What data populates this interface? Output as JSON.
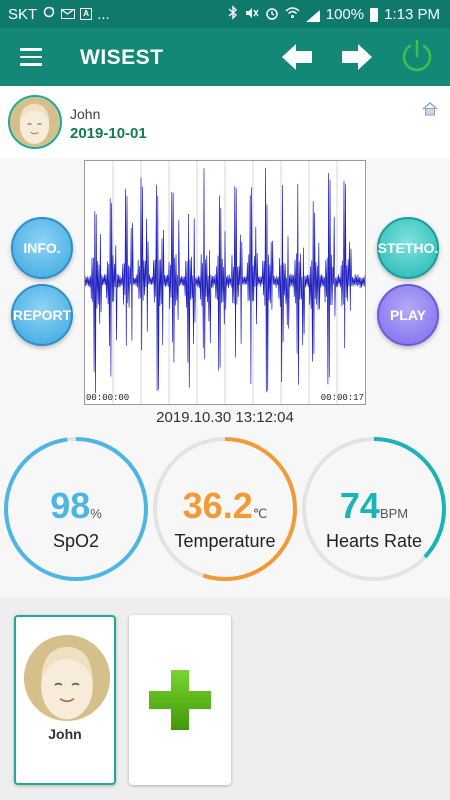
{
  "status_bar": {
    "carrier": "SKT",
    "battery": "100%",
    "time": "1:13 PM",
    "overflow": "..."
  },
  "app_bar": {
    "title": "WISEST",
    "icons": [
      "menu-icon",
      "arrow-left-icon",
      "arrow-right-icon",
      "power-icon"
    ],
    "power_color": "#39c44a"
  },
  "profile": {
    "name": "John",
    "date": "2019-10-01"
  },
  "buttons": {
    "info": "INFO.",
    "report": "REPORT",
    "stetho": "STETHO.",
    "play": "PLAY"
  },
  "waveform": {
    "start_time": "00:00:00",
    "end_time": "00:00:17",
    "color": "#1f1fbf"
  },
  "recording_timestamp": "2019.10.30 13:12:04",
  "vitals": [
    {
      "value": "98",
      "unit": "%",
      "label": "SpO2",
      "color": "#4fb6e3",
      "fraction": 0.98
    },
    {
      "value": "36.2",
      "unit": "℃",
      "label": "Temperature",
      "color": "#f19a36",
      "fraction": 0.55
    },
    {
      "value": "74",
      "unit": "BPM",
      "label": "Hearts Rate",
      "color": "#1ab3b8",
      "fraction": 0.37
    }
  ],
  "users": [
    {
      "name": "John"
    }
  ],
  "add_user_color": "#52b80e"
}
